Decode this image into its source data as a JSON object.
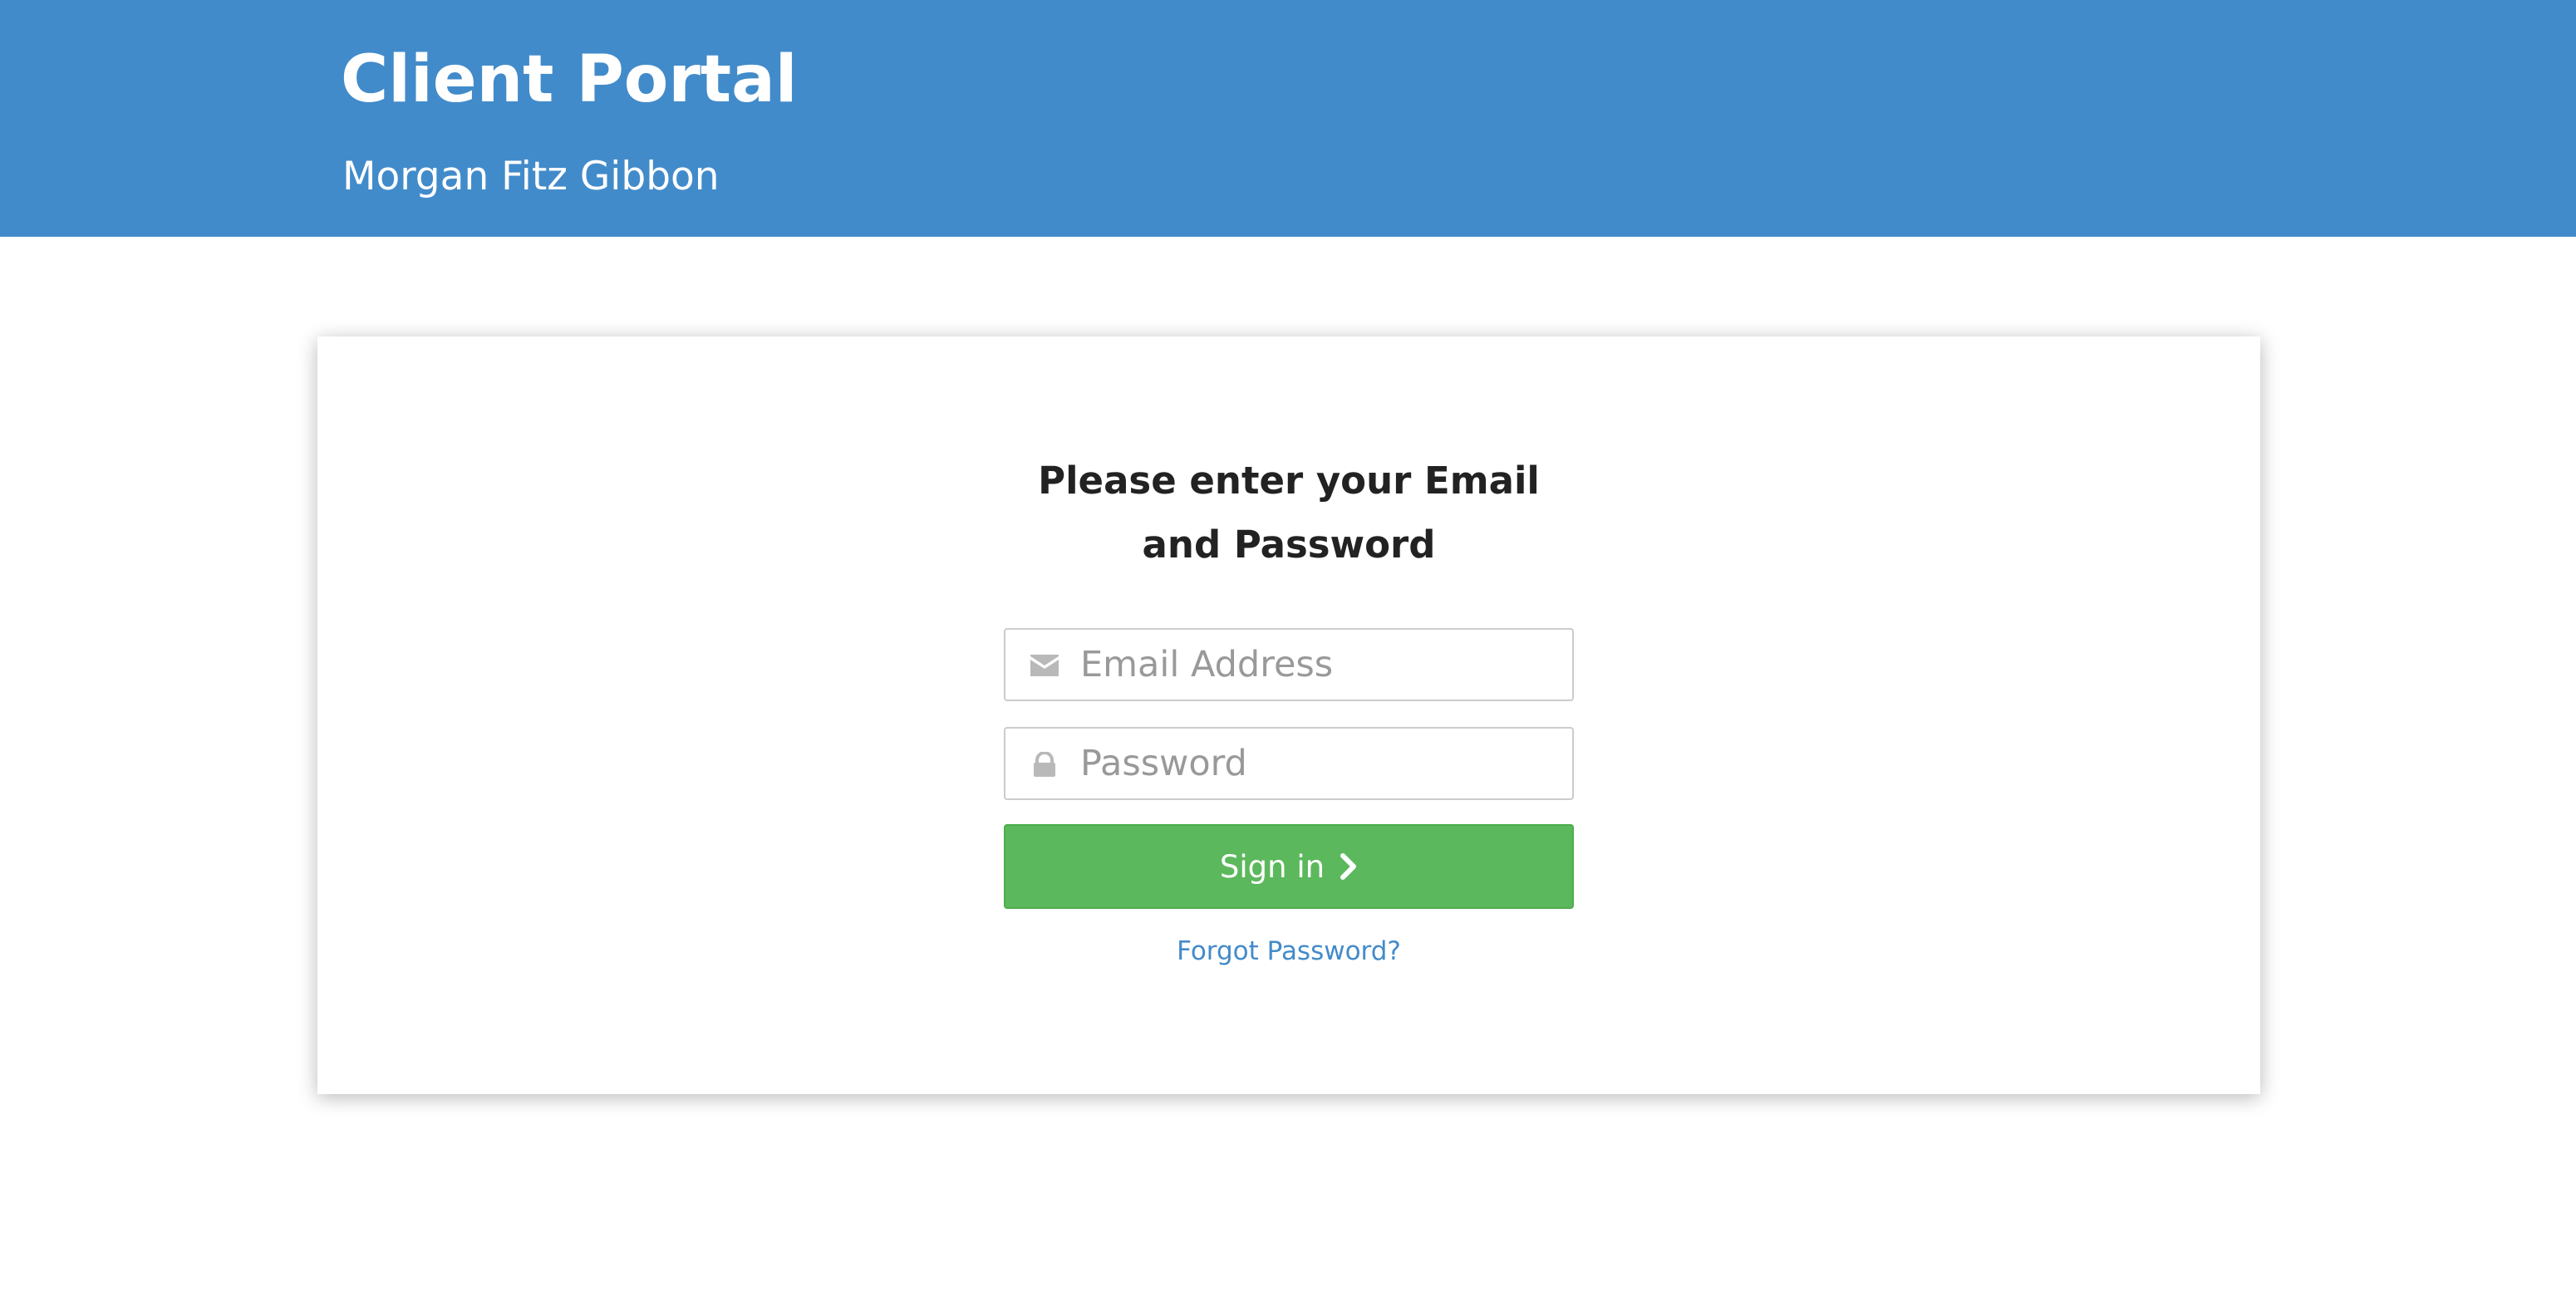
{
  "header": {
    "title": "Client Portal",
    "subtitle": "Morgan Fitz Gibbon",
    "background_color": "#428bca"
  },
  "login": {
    "heading_line1": "Please enter your Email",
    "heading_line2": "and Password",
    "email": {
      "placeholder": "Email Address",
      "value": "",
      "icon": "envelope-icon"
    },
    "password": {
      "placeholder": "Password",
      "value": "",
      "icon": "lock-icon"
    },
    "signin_label": "Sign in",
    "signin_icon": "chevron-right-icon",
    "signin_color": "#5cb85c",
    "forgot_label": "Forgot Password?",
    "link_color": "#428bca"
  }
}
